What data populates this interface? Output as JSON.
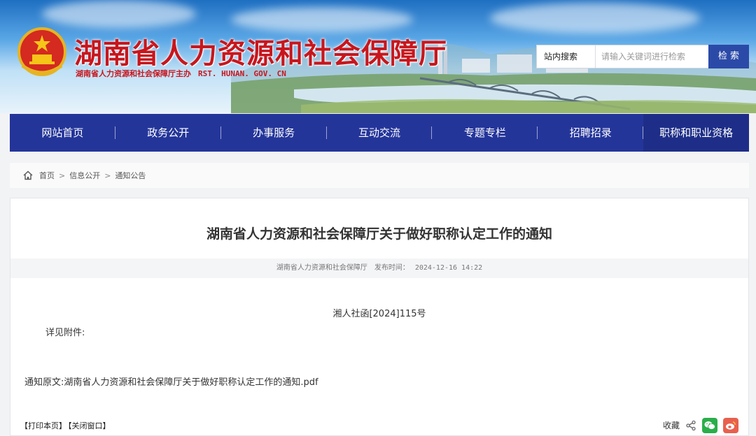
{
  "header": {
    "title": "湖南省人力资源和社会保障厅",
    "subtitle": "湖南省人力资源和社会保障厅主办",
    "url": "RST. HUNAN. GOV. CN",
    "emblem_icon": "national-emblem-icon"
  },
  "search": {
    "scope_label": "站内搜索",
    "placeholder": "请输入关键词进行检索",
    "button_label": "检 索"
  },
  "nav": {
    "items": [
      {
        "label": "网站首页"
      },
      {
        "label": "政务公开"
      },
      {
        "label": "办事服务"
      },
      {
        "label": "互动交流"
      },
      {
        "label": "专题专栏"
      },
      {
        "label": "招聘招录"
      },
      {
        "label": "职称和职业资格"
      }
    ]
  },
  "breadcrumb": {
    "items": [
      "首页",
      "信息公开",
      "通知公告"
    ],
    "separator": ">"
  },
  "article": {
    "title": "湖南省人力资源和社会保障厅关于做好职称认定工作的通知",
    "source": "湖南省人力资源和社会保障厅",
    "published_label": "发布时间：",
    "published_date": "2024-12-16 14:22",
    "doc_number": "湘人社函[2024]115号",
    "body_line1": "详见附件:",
    "attachment_prefix": "通知原文:",
    "attachment_link": "湖南省人力资源和社会保障厅关于做好职称认定工作的通知.pdf"
  },
  "footer": {
    "print_label": "【打印本页】",
    "close_label": "【关闭窗口】",
    "favorite_label": "收藏",
    "share_icon": "share-icon",
    "wechat_icon": "wechat-icon",
    "weibo_icon": "weibo-icon"
  },
  "colors": {
    "brand_red": "#c8161d",
    "nav_blue": "#24359a",
    "search_button": "#2b4aa8"
  }
}
